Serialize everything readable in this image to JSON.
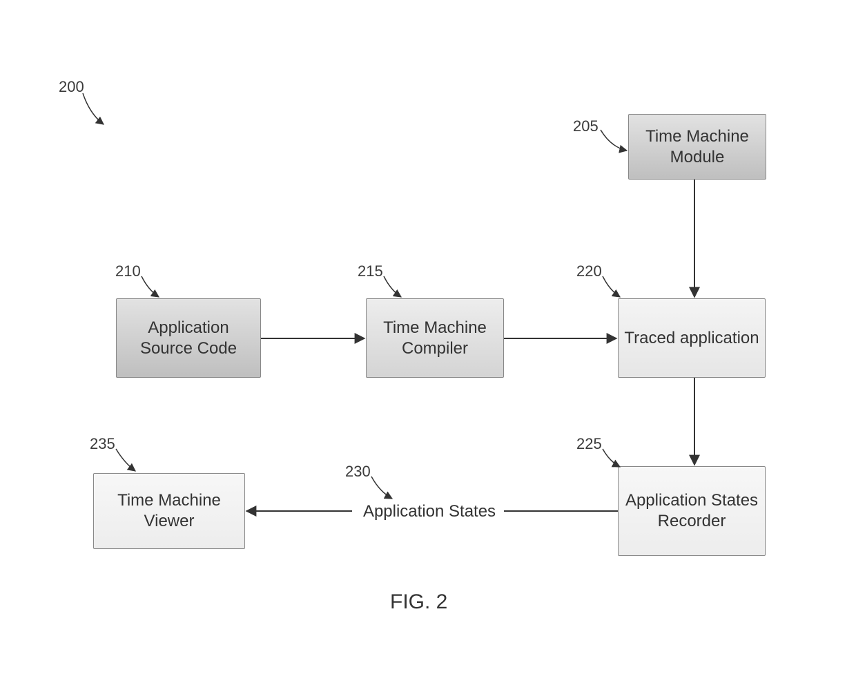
{
  "diagram": {
    "figure_label": "FIG. 2",
    "overall_ref": "200",
    "nodes": {
      "n205": {
        "ref": "205",
        "label": "Time Machine Module"
      },
      "n210": {
        "ref": "210",
        "label": "Application Source Code"
      },
      "n215": {
        "ref": "215",
        "label": "Time Machine Compiler"
      },
      "n220": {
        "ref": "220",
        "label": "Traced application"
      },
      "n225": {
        "ref": "225",
        "label": "Application States Recorder"
      },
      "n230": {
        "ref": "230",
        "label": "Application States"
      },
      "n235": {
        "ref": "235",
        "label": "Time Machine Viewer"
      }
    },
    "edges": [
      {
        "from": "n210",
        "to": "n215"
      },
      {
        "from": "n215",
        "to": "n220"
      },
      {
        "from": "n205",
        "to": "n220"
      },
      {
        "from": "n220",
        "to": "n225"
      },
      {
        "from": "n225",
        "to": "n230"
      },
      {
        "from": "n230",
        "to": "n235"
      }
    ]
  }
}
